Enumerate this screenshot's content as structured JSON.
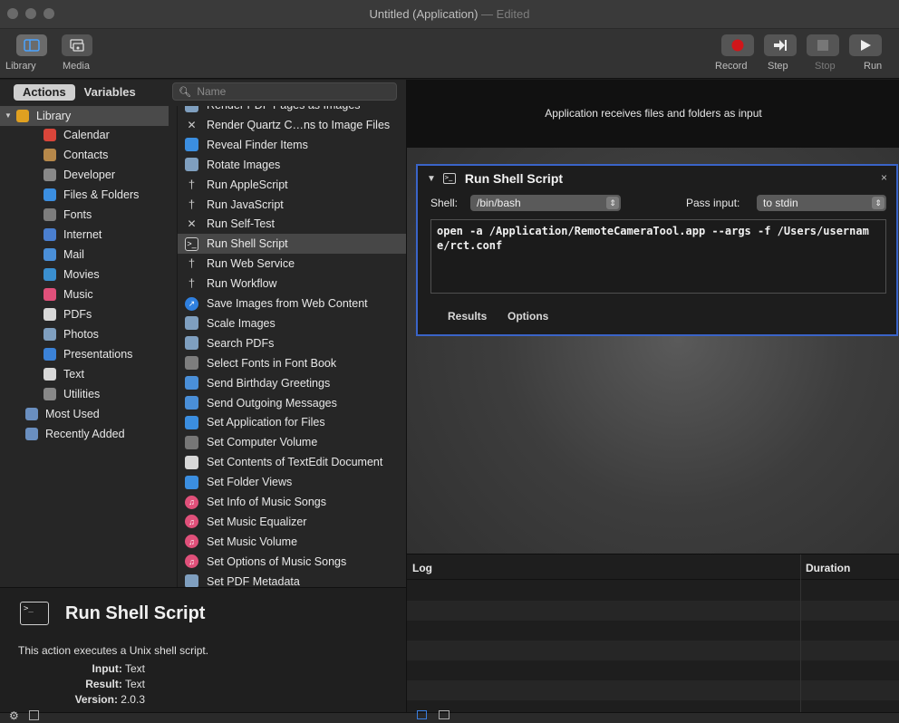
{
  "window": {
    "title": "Untitled (Application)",
    "title_suffix": " — Edited"
  },
  "toolbar": {
    "library_label": "Library",
    "media_label": "Media",
    "record_label": "Record",
    "step_label": "Step",
    "stop_label": "Stop",
    "run_label": "Run"
  },
  "tabs": {
    "actions": "Actions",
    "variables": "Variables"
  },
  "search": {
    "placeholder": "Name"
  },
  "library": [
    {
      "label": "Library",
      "icon": "library-icon",
      "color": "#e0a020"
    },
    {
      "label": "Calendar",
      "icon": "calendar-icon",
      "color": "#d9453a"
    },
    {
      "label": "Contacts",
      "icon": "contacts-icon",
      "color": "#b6884a"
    },
    {
      "label": "Developer",
      "icon": "hammer-icon",
      "color": "#888888"
    },
    {
      "label": "Files & Folders",
      "icon": "finder-icon",
      "color": "#3b8ee0"
    },
    {
      "label": "Fonts",
      "icon": "fonts-icon",
      "color": "#7d7d7d"
    },
    {
      "label": "Internet",
      "icon": "globe-icon",
      "color": "#4a7fd0"
    },
    {
      "label": "Mail",
      "icon": "mail-icon",
      "color": "#4a8fd8"
    },
    {
      "label": "Movies",
      "icon": "movies-icon",
      "color": "#3a8fd0"
    },
    {
      "label": "Music",
      "icon": "music-icon",
      "color": "#e0507a"
    },
    {
      "label": "PDFs",
      "icon": "pdf-icon",
      "color": "#d8d8d8"
    },
    {
      "label": "Photos",
      "icon": "photos-icon",
      "color": "#7f9fbf"
    },
    {
      "label": "Presentations",
      "icon": "presentations-icon",
      "color": "#3b82d8"
    },
    {
      "label": "Text",
      "icon": "text-icon",
      "color": "#d8d8d8"
    },
    {
      "label": "Utilities",
      "icon": "utilities-icon",
      "color": "#888888"
    },
    {
      "label": "Most Used",
      "icon": "folder-icon",
      "color": "#6a8fc0"
    },
    {
      "label": "Recently Added",
      "icon": "folder-icon",
      "color": "#6a8fc0"
    }
  ],
  "actions": [
    {
      "label": "Render PDF Pages as Images",
      "icon": "image-icon",
      "color": "#7f9fbf"
    },
    {
      "label": "Render Quartz C…ns to Image Files",
      "icon": "hammer-icon",
      "color": "#888888"
    },
    {
      "label": "Reveal Finder Items",
      "icon": "finder-icon",
      "color": "#3b8ee0"
    },
    {
      "label": "Rotate Images",
      "icon": "image-icon",
      "color": "#7f9fbf"
    },
    {
      "label": "Run AppleScript",
      "icon": "script-icon",
      "color": "#9a9a9a"
    },
    {
      "label": "Run JavaScript",
      "icon": "script-icon",
      "color": "#9a9a9a"
    },
    {
      "label": "Run Self-Test",
      "icon": "hammer-icon",
      "color": "#888888"
    },
    {
      "label": "Run Shell Script",
      "icon": "terminal-icon",
      "color": "#333333"
    },
    {
      "label": "Run Web Service",
      "icon": "script-icon",
      "color": "#9a9a9a"
    },
    {
      "label": "Run Workflow",
      "icon": "script-icon",
      "color": "#9a9a9a"
    },
    {
      "label": "Save Images from Web Content",
      "icon": "safari-icon",
      "color": "#2f80e0"
    },
    {
      "label": "Scale Images",
      "icon": "image-icon",
      "color": "#7f9fbf"
    },
    {
      "label": "Search PDFs",
      "icon": "image-icon",
      "color": "#7f9fbf"
    },
    {
      "label": "Select Fonts in Font Book",
      "icon": "fonts-icon",
      "color": "#7d7d7d"
    },
    {
      "label": "Send Birthday Greetings",
      "icon": "mail-icon",
      "color": "#4a8fd8"
    },
    {
      "label": "Send Outgoing Messages",
      "icon": "mail-icon",
      "color": "#4a8fd8"
    },
    {
      "label": "Set Application for Files",
      "icon": "finder-icon",
      "color": "#3b8ee0"
    },
    {
      "label": "Set Computer Volume",
      "icon": "volume-icon",
      "color": "#777777"
    },
    {
      "label": "Set Contents of TextEdit Document",
      "icon": "textedit-icon",
      "color": "#d8d8d8"
    },
    {
      "label": "Set Folder Views",
      "icon": "finder-icon",
      "color": "#3b8ee0"
    },
    {
      "label": "Set Info of Music Songs",
      "icon": "music-icon",
      "color": "#e0507a"
    },
    {
      "label": "Set Music Equalizer",
      "icon": "music-icon",
      "color": "#e0507a"
    },
    {
      "label": "Set Music Volume",
      "icon": "music-icon",
      "color": "#e0507a"
    },
    {
      "label": "Set Options of Music Songs",
      "icon": "music-icon",
      "color": "#e0507a"
    },
    {
      "label": "Set PDF Metadata",
      "icon": "image-icon",
      "color": "#7f9fbf"
    }
  ],
  "description": {
    "title": "Run Shell Script",
    "icon_text": ">_",
    "text": "This action executes a Unix shell script.",
    "input_label": "Input:",
    "input_value": "Text",
    "result_label": "Result:",
    "result_value": "Text",
    "version_label": "Version:",
    "version_value": "2.0.3"
  },
  "workflow": {
    "receives_text": "Application receives files and folders as input",
    "action": {
      "title": "Run Shell Script",
      "close": "×",
      "shell_label": "Shell:",
      "shell_value": "/bin/bash",
      "pass_label": "Pass input:",
      "pass_value": "to stdin",
      "script": "open -a /Application/RemoteCameraTool.app --args -f /Users/username/rct.conf",
      "results_tab": "Results",
      "options_tab": "Options"
    }
  },
  "log": {
    "log_header": "Log",
    "duration_header": "Duration"
  },
  "colors": {
    "record": "#d0161a",
    "accent": "#3a64c8"
  }
}
